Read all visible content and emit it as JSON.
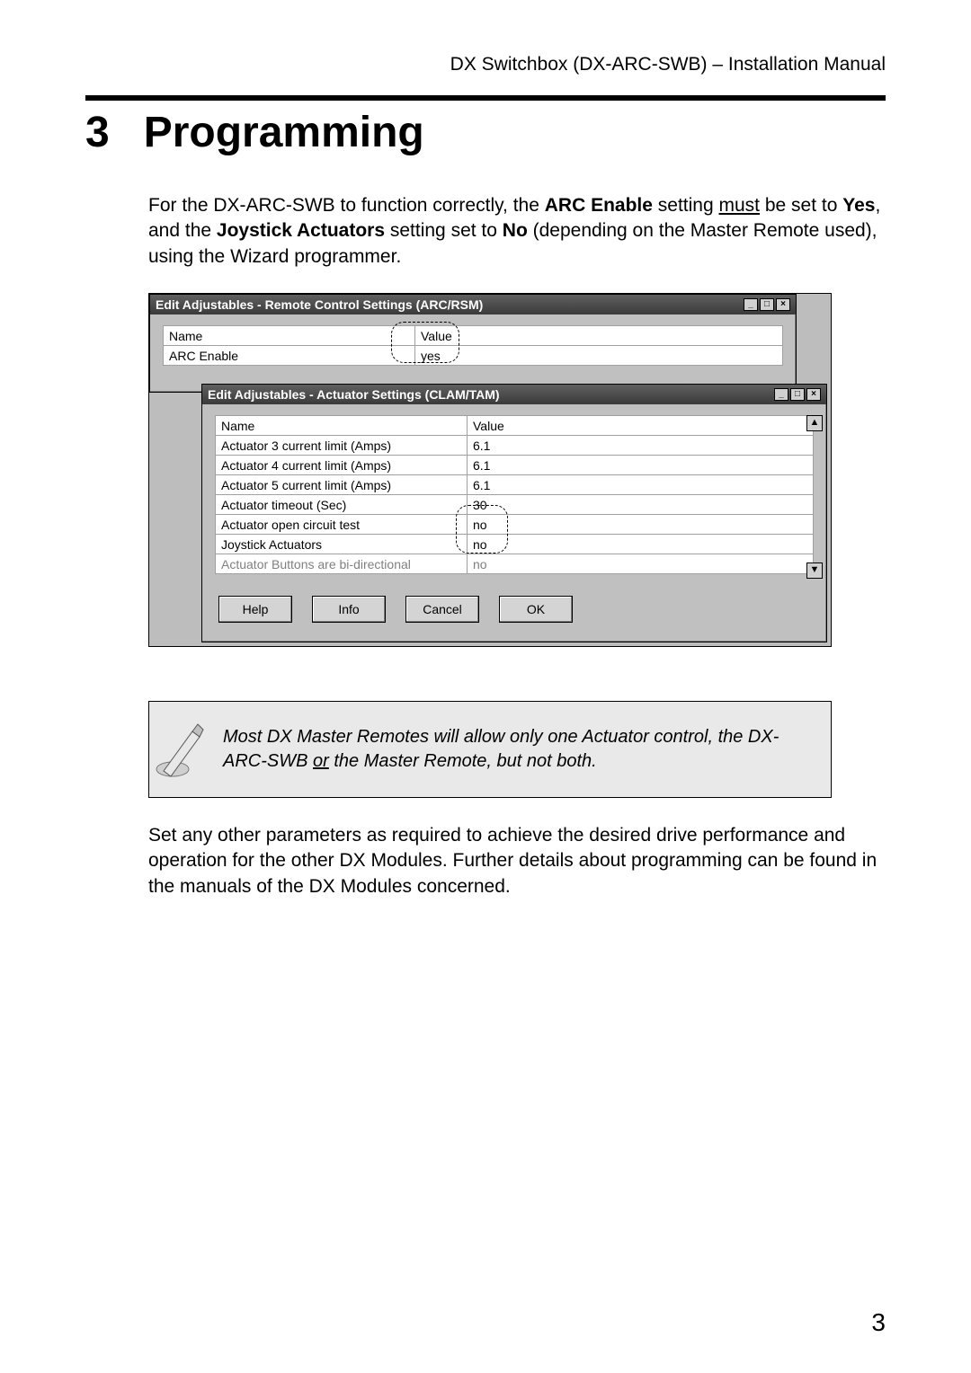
{
  "header": {
    "right": "DX Switchbox (DX-ARC-SWB) – Installation Manual"
  },
  "chapter": {
    "num": "3",
    "title": "Programming"
  },
  "intro": {
    "p1_a": "For the DX-ARC-SWB to function correctly, the ",
    "p1_b": "ARC Enable",
    "p1_c": " setting ",
    "p1_d": "must",
    "p1_e": " be set to ",
    "p1_f": "Yes",
    "p1_g": ", and the ",
    "p1_h": "Joystick Actuators",
    "p1_i": " setting set to ",
    "p1_j": "No",
    "p1_k": " (depending on the Master Remote used), using the Wizard programmer."
  },
  "win1": {
    "title": "Edit Adjustables - Remote Control Settings (ARC/RSM)",
    "cols": {
      "name": "Name",
      "value": "Value"
    },
    "row": {
      "name": "ARC Enable",
      "value": "yes"
    }
  },
  "win2": {
    "title": "Edit Adjustables - Actuator Settings (CLAM/TAM)",
    "cols": {
      "name": "Name",
      "value": "Value"
    },
    "rows": [
      {
        "name": "Actuator 3 current limit (Amps)",
        "value": "6.1"
      },
      {
        "name": "Actuator 4 current limit (Amps)",
        "value": "6.1"
      },
      {
        "name": "Actuator 5 current limit (Amps)",
        "value": "6.1"
      },
      {
        "name": "Actuator timeout (Sec)",
        "value": "30"
      },
      {
        "name": "Actuator open circuit test",
        "value": "no"
      },
      {
        "name": "Joystick Actuators",
        "value": "no"
      },
      {
        "name": "Actuator Buttons are bi-directional",
        "value": "no"
      }
    ],
    "buttons": {
      "help": "Help",
      "info": "Info",
      "cancel": "Cancel",
      "ok": "OK"
    }
  },
  "winctrl": {
    "min": "_",
    "max": "□",
    "close": "×"
  },
  "scroll": {
    "up": "▲",
    "down": "▼"
  },
  "note": {
    "t1": "Most DX Master Remotes will allow only one Actuator control, the DX-ARC-SWB ",
    "t2": "or",
    "t3": " the Master Remote, but not both."
  },
  "outro": "Set any other parameters as required to achieve the desired drive performance and operation for the other DX Modules. Further details about programming can be found in the manuals of the DX Modules concerned.",
  "page": "3"
}
